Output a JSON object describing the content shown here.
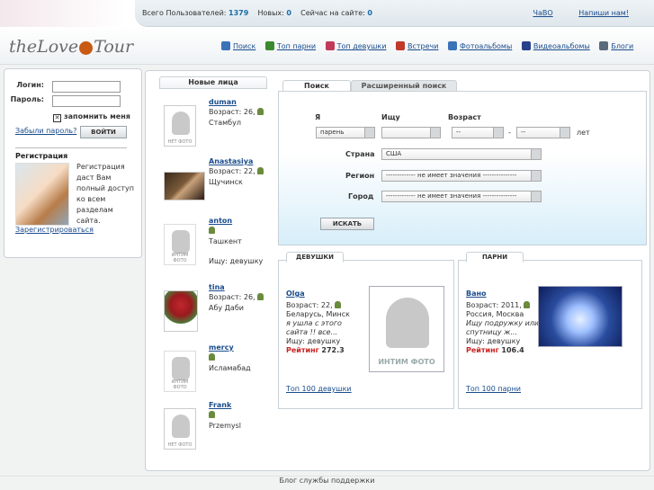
{
  "header": {
    "stats": {
      "users_label": "Всего Пользователей:",
      "users": "1379",
      "new_label": "Новых:",
      "new": "0",
      "online_label": "Сейчас на сайте:",
      "online": "0"
    },
    "links": [
      "ЧаВО",
      "Напиши нам!"
    ]
  },
  "logo": {
    "left": "theLove",
    "right": "Tour"
  },
  "nav": [
    {
      "label": "Поиск",
      "color": "#3b73b8"
    },
    {
      "label": "Топ парни",
      "color": "#3c8a2e"
    },
    {
      "label": "Топ девушки",
      "color": "#c23a5a"
    },
    {
      "label": "Встречи",
      "color": "#c0392b"
    },
    {
      "label": "Фотоальбомы",
      "color": "#3b73b8"
    },
    {
      "label": "Видеоальбомы",
      "color": "#26428b"
    },
    {
      "label": "Блоги",
      "color": "#5a6b7b"
    }
  ],
  "login": {
    "login_label": "Логин:",
    "password_label": "Пароль:",
    "remember": "запомнить меня",
    "forgot": "Забыли пароль?",
    "submit": "ВОЙТИ"
  },
  "registration": {
    "title": "Регистрация",
    "text": "Регистрация даст Вам полный доступ ко всем разделам сайта.",
    "link": "Зарегистрироваться"
  },
  "faces": {
    "tab": "Новые лица",
    "no_photo": "НЕТ ФОТО",
    "intim_photo": "ИНТИМ ФОТО",
    "items": [
      {
        "name": "duman",
        "l1": "Возраст: 26,",
        "l2": "Стамбул",
        "l3": ""
      },
      {
        "name": "Anastasiya",
        "l1": "Возраст: 22,",
        "l2": "Щучинск",
        "l3": ""
      },
      {
        "name": "anton",
        "l1": "",
        "l2": "Ташкент",
        "l3": "Ищу: девушку"
      },
      {
        "name": "tina",
        "l1": "Возраст: 26,",
        "l2": "Абу Даби",
        "l3": ""
      },
      {
        "name": "mercy",
        "l1": "",
        "l2": "Исламабад",
        "l3": ""
      },
      {
        "name": "Frank",
        "l1": "",
        "l2": "Przemysl",
        "l3": ""
      }
    ]
  },
  "search": {
    "tab_basic": "Поиск",
    "tab_advanced": "Расширенный поиск",
    "i_label": "Я",
    "seek_label": "Ищу",
    "age_label": "Возраст",
    "i_value": "парень",
    "seek_value": "",
    "age_from": "--",
    "dash": "-",
    "age_to": "--",
    "years": "лет",
    "country_label": "Страна",
    "country_value": "США",
    "region_label": "Регион",
    "region_value": "------------- не имеет значения ---------------",
    "city_label": "Город",
    "city_value": "------------- не имеет значения ---------------",
    "submit": "ИСКАТЬ"
  },
  "girls": {
    "tab": "ДЕВУШКИ",
    "name": "Olga",
    "age": "Возраст: 22,",
    "place": "Беларусь, Минск",
    "quote": "я ушла с этого сайта !! все...",
    "seek": "Ищу: девушку",
    "rating_label": "Рейтинг",
    "rating": "272.3",
    "photo_caption": "ИНТИМ ФОТО",
    "top": "Топ 100 девушки"
  },
  "boys": {
    "tab": "ПАРНИ",
    "name": "Вано",
    "age": "Возраст: 2011,",
    "place": "Россия, Москва",
    "quote": "Ищу подружку или спутницу ж...",
    "seek": "Ищу: девушку",
    "rating_label": "Рейтинг",
    "rating": "106.4",
    "top": "Топ 100 парни"
  },
  "footer": "Блог службы поддержки"
}
